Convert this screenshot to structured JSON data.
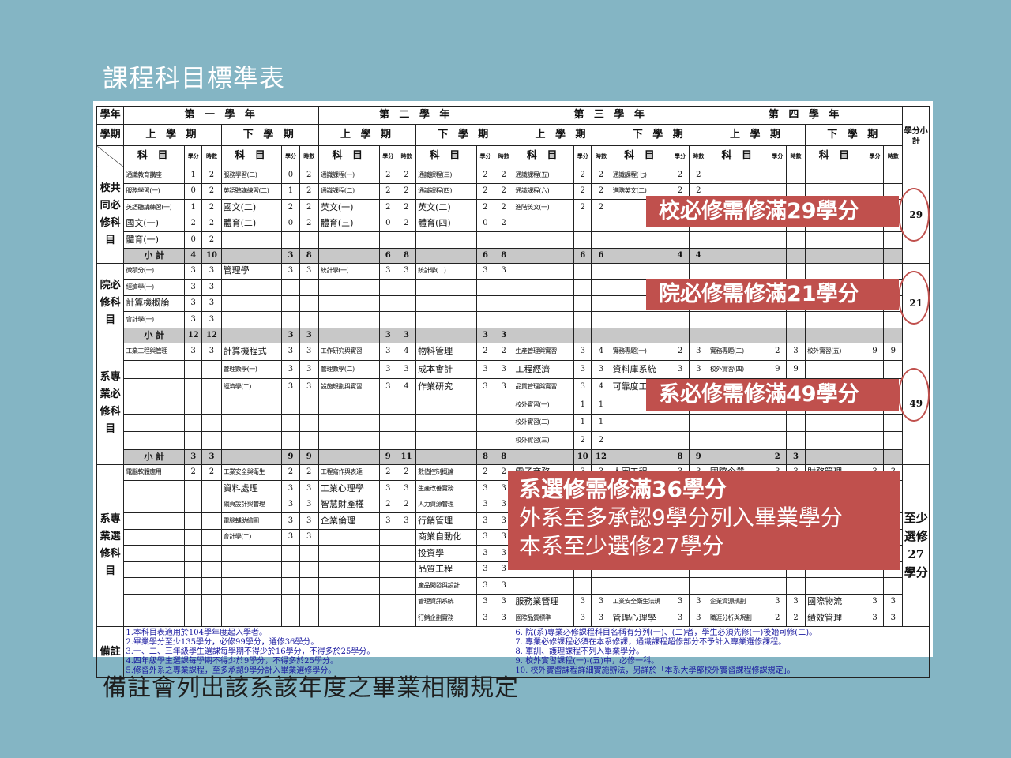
{
  "slide": {
    "title": "課程科目標準表",
    "caption": "備註會列出該系該年度之畢業相關規定"
  },
  "colors": {
    "background": "#84b5c4",
    "callout": "#c0504d"
  },
  "table": {
    "h_year": "學年",
    "h_term": "學期",
    "years": [
      "第 一 學 年",
      "第 二 學 年",
      "第 三 學 年",
      "第 四 學 年"
    ],
    "terms": [
      "上 學 期",
      "下 學 期"
    ],
    "col_course": "科 目",
    "col_credit": "學分",
    "col_hours": "時數",
    "total_head": "學分小計",
    "subtotal_label": "小 計",
    "groups": {
      "school": {
        "label": "校共同必修科目",
        "rows": [
          [
            "通識教育講座",
            "1",
            "2",
            "服務學習(二)",
            "0",
            "2",
            "通識課程(一)",
            "2",
            "2",
            "通識課程(三)",
            "2",
            "2",
            "通識課程(五)",
            "2",
            "2",
            "通識課程(七)",
            "2",
            "2",
            "",
            "",
            "",
            "",
            "",
            ""
          ],
          [
            "服務學習(一)",
            "0",
            "2",
            "英語聽講練習(二)",
            "1",
            "2",
            "通識課程(二)",
            "2",
            "2",
            "通識課程(四)",
            "2",
            "2",
            "通識課程(六)",
            "2",
            "2",
            "進階英文(二)",
            "2",
            "2",
            "",
            "",
            "",
            "",
            "",
            ""
          ],
          [
            "英語聽講練習(一)",
            "1",
            "2",
            "國文(二)",
            "2",
            "2",
            "英文(一)",
            "2",
            "2",
            "英文(二)",
            "2",
            "2",
            "進階英文(一)",
            "2",
            "2",
            "",
            "",
            "",
            "",
            "",
            "",
            "",
            "",
            ""
          ],
          [
            "國文(一)",
            "2",
            "2",
            "體育(二)",
            "0",
            "2",
            "體育(三)",
            "0",
            "2",
            "體育(四)",
            "0",
            "2",
            "",
            "",
            "",
            "",
            "",
            "",
            "",
            "",
            "",
            "",
            "",
            ""
          ],
          [
            "體育(一)",
            "0",
            "2",
            "",
            "",
            "",
            "",
            "",
            "",
            "",
            "",
            "",
            "",
            "",
            "",
            "",
            "",
            "",
            "",
            "",
            "",
            "",
            "",
            ""
          ]
        ],
        "subtotal": [
          "4",
          "10",
          "3",
          "8",
          "6",
          "8",
          "6",
          "8",
          "6",
          "6",
          "4",
          "4",
          "",
          ""
        ],
        "total": "29"
      },
      "college": {
        "label": "院必修科目",
        "rows": [
          [
            "微積分(一)",
            "3",
            "3",
            "管理學",
            "3",
            "3",
            "統計學(一)",
            "3",
            "3",
            "統計學(二)",
            "3",
            "3",
            "",
            "",
            "",
            "",
            "",
            "",
            "",
            "",
            "",
            "",
            "",
            ""
          ],
          [
            "經濟學(一)",
            "3",
            "3",
            "",
            "",
            "",
            "",
            "",
            "",
            "",
            "",
            "",
            "",
            "",
            "",
            "",
            "",
            "",
            "",
            "",
            "",
            "",
            "",
            ""
          ],
          [
            "計算機概論",
            "3",
            "3",
            "",
            "",
            "",
            "",
            "",
            "",
            "",
            "",
            "",
            "",
            "",
            "",
            "",
            "",
            "",
            "",
            "",
            "",
            "",
            "",
            ""
          ],
          [
            "會計學(一)",
            "3",
            "3",
            "",
            "",
            "",
            "",
            "",
            "",
            "",
            "",
            "",
            "",
            "",
            "",
            "",
            "",
            "",
            "",
            "",
            "",
            "",
            "",
            ""
          ]
        ],
        "subtotal": [
          "12",
          "12",
          "3",
          "3",
          "3",
          "3",
          "3",
          "3",
          "",
          "",
          "",
          "",
          "",
          ""
        ],
        "total": "21"
      },
      "dept": {
        "label": "系專業必修科目",
        "rows": [
          [
            "工業工程與管理",
            "3",
            "3",
            "計算機程式",
            "3",
            "3",
            "工作研究與實習",
            "3",
            "4",
            "物料管理",
            "2",
            "2",
            "生產管理與實習",
            "3",
            "4",
            "實務專題(一)",
            "2",
            "3",
            "實務專題(二)",
            "2",
            "3",
            "校外實習(五)",
            "9",
            "9"
          ],
          [
            "",
            "",
            "",
            "管理數學(一)",
            "3",
            "3",
            "管理數學(二)",
            "3",
            "3",
            "成本會計",
            "3",
            "3",
            "工程經濟",
            "3",
            "3",
            "資料庫系統",
            "3",
            "3",
            "校外實習(四)",
            "9",
            "9",
            "",
            "",
            ""
          ],
          [
            "",
            "",
            "",
            "經濟學(二)",
            "3",
            "3",
            "設施規劃與實習",
            "3",
            "4",
            "作業研究",
            "3",
            "3",
            "品質管理與實習",
            "3",
            "4",
            "可靠度工程",
            "3",
            "3",
            "",
            "",
            "",
            "",
            "",
            ""
          ],
          [
            "",
            "",
            "",
            "",
            "",
            "",
            "",
            "",
            "",
            "",
            "",
            "",
            "校外實習(一)",
            "1",
            "1",
            "",
            "",
            "",
            "",
            "",
            "",
            "",
            "",
            ""
          ],
          [
            "",
            "",
            "",
            "",
            "",
            "",
            "",
            "",
            "",
            "",
            "",
            "",
            "校外實習(二)",
            "1",
            "1",
            "",
            "",
            "",
            "",
            "",
            "",
            "",
            "",
            ""
          ],
          [
            "",
            "",
            "",
            "",
            "",
            "",
            "",
            "",
            "",
            "",
            "",
            "",
            "校外實習(三)",
            "2",
            "2",
            "",
            "",
            "",
            "",
            "",
            "",
            "",
            "",
            ""
          ]
        ],
        "subtotal": [
          "3",
          "3",
          "9",
          "9",
          "9",
          "11",
          "8",
          "8",
          "10",
          "12",
          "8",
          "9",
          "2",
          "3"
        ],
        "total": "49"
      },
      "elective": {
        "label": "系專業選修科目",
        "total": "至少選修27學分",
        "rows": [
          [
            "電腦軟體應用",
            "2",
            "2",
            "工業安全與衛生",
            "2",
            "2",
            "工程寫作與表達",
            "2",
            "2",
            "數值控制概論",
            "2",
            "2",
            "電子商務",
            "3",
            "3",
            "人因工程",
            "3",
            "3",
            "國際企業",
            "3",
            "3",
            "財務管理",
            "3",
            "3"
          ],
          [
            "",
            "",
            "",
            "資料處理",
            "3",
            "3",
            "工業心理學",
            "3",
            "3",
            "生產改善實務",
            "3",
            "3",
            "",
            "",
            "",
            "",
            "",
            "",
            "",
            "",
            "",
            "",
            "",
            ""
          ],
          [
            "",
            "",
            "",
            "網頁設計與管理",
            "3",
            "3",
            "智慧財產權",
            "2",
            "2",
            "人力資源管理",
            "3",
            "3",
            "",
            "",
            "",
            "",
            "",
            "",
            "",
            "",
            "",
            "",
            "",
            ""
          ],
          [
            "",
            "",
            "",
            "電腦輔助繪圖",
            "3",
            "3",
            "企業倫理",
            "3",
            "3",
            "行銷管理",
            "3",
            "3",
            "",
            "",
            "",
            "",
            "",
            "",
            "",
            "",
            "",
            "",
            "",
            ""
          ],
          [
            "",
            "",
            "",
            "會計學(二)",
            "3",
            "3",
            "",
            "",
            "",
            "商業自動化",
            "3",
            "3",
            "",
            "",
            "",
            "",
            "",
            "",
            "",
            "",
            "",
            "",
            "",
            ""
          ],
          [
            "",
            "",
            "",
            "",
            "",
            "",
            "",
            "",
            "",
            "投資學",
            "3",
            "3",
            "",
            "",
            "",
            "",
            "",
            "",
            "",
            "",
            "",
            "",
            "",
            ""
          ],
          [
            "",
            "",
            "",
            "",
            "",
            "",
            "",
            "",
            "",
            "品質工程",
            "3",
            "3",
            "",
            "",
            "",
            "",
            "",
            "",
            "",
            "",
            "",
            "",
            "",
            ""
          ],
          [
            "",
            "",
            "",
            "",
            "",
            "",
            "",
            "",
            "",
            "產品開發與設計",
            "3",
            "3",
            "",
            "",
            "",
            "",
            "",
            "",
            "",
            "",
            "",
            "",
            "",
            ""
          ],
          [
            "",
            "",
            "",
            "",
            "",
            "",
            "",
            "",
            "",
            "管理資訊系統",
            "3",
            "3",
            "服務業管理",
            "3",
            "3",
            "工業安全衛生法規",
            "3",
            "3",
            "企業資源規劃",
            "3",
            "3",
            "國際物流",
            "3",
            "3"
          ],
          [
            "",
            "",
            "",
            "",
            "",
            "",
            "",
            "",
            "",
            "行銷企劃實務",
            "3",
            "3",
            "國際品質標準",
            "3",
            "3",
            "管理心理學",
            "3",
            "3",
            "職涯分析與規劃",
            "2",
            "2",
            "績效管理",
            "3",
            "3"
          ]
        ]
      }
    },
    "notes_label": "備註",
    "notes_left": [
      "1.本科目表適用於104學年度起入學者。",
      "2.畢業學分至少135學分，必修99學分，選修36學分。",
      "3.一、二、三年級學生選課每學期不得少於16學分，不得多於25學分。",
      "4.四年級學生選課每學期不得少於9學分，不得多於25學分。",
      "5.修習外系之專業課程，至多承認9學分計入畢業選修學分。"
    ],
    "notes_right": [
      "6. 院(系)專業必修課程科目名稱有分列(一)、(二)者，學生必須先修(一)後始可修(二)。",
      "7. 專業必修課程必須在本系修課，通識課程超修部分不予計入專業選修課程。",
      "8. 軍訓、護理課程不列入畢業學分。",
      "9. 校外實習課程(一)-(五)中，必修一科。",
      "10. 校外實習課程詳細實施辦法，另詳於「本系大學部校外實習課程修課規定」。"
    ]
  },
  "callouts": {
    "school": "校必修需修滿29學分",
    "college": "院必修需修滿21學分",
    "dept": "系必修需修滿49學分",
    "elective": [
      "系選修需修滿36學分",
      "外系至多承認9學分列入畢業學分",
      "本系至少選修27學分"
    ]
  }
}
